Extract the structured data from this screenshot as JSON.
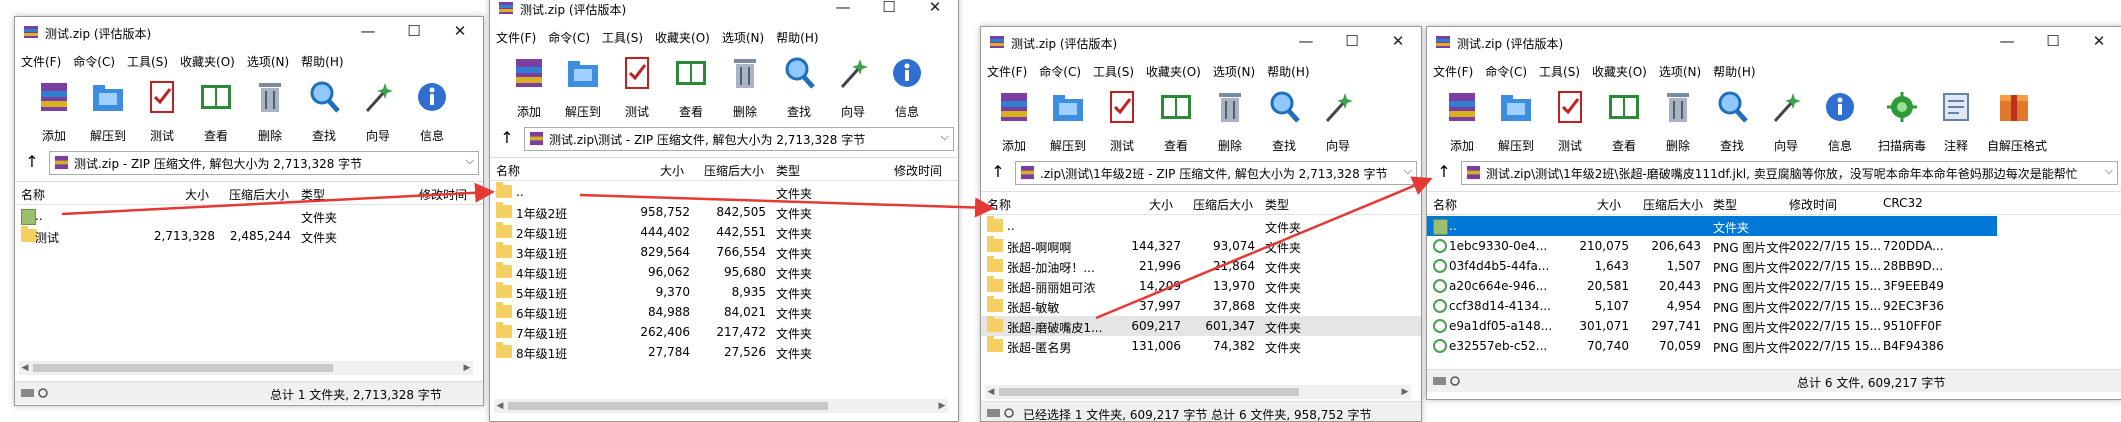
{
  "common": {
    "menu": [
      "文件(F)",
      "命令(C)",
      "工具(S)",
      "收藏夹(O)",
      "选项(N)",
      "帮助(H)"
    ],
    "toolbar": [
      "添加",
      "解压到",
      "测试",
      "查看",
      "删除",
      "查找",
      "向导",
      "信息"
    ],
    "cols": {
      "name": "名称",
      "size": "大小",
      "packed": "压缩后大小",
      "type": "类型",
      "modified": "修改时间",
      "crc": "CRC32"
    },
    "folder_type": "文件夹",
    "png_type": "PNG 图片文件",
    "parent": ".."
  },
  "accent_color": "#0078d7",
  "arrow_color": "#e53935",
  "win1": {
    "title": "测试.zip (评估版本)",
    "address": "测试.zip - ZIP 压缩文件, 解包大小为 2,713,328 字节",
    "rows": [
      {
        "name": "..",
        "size": "",
        "packed": "",
        "type": "文件夹"
      },
      {
        "name": "测试",
        "size": "2,713,328",
        "packed": "2,485,244",
        "type": "文件夹"
      }
    ],
    "status": "总计 1 文件夹, 2,713,328 字节"
  },
  "win2": {
    "title": "测试.zip (评估版本)",
    "address": "测试.zip\\测试 - ZIP 压缩文件, 解包大小为 2,713,328 字节",
    "rows": [
      {
        "name": "..",
        "size": "",
        "packed": "",
        "type": "文件夹"
      },
      {
        "name": "1年级2班",
        "size": "958,752",
        "packed": "842,505",
        "type": "文件夹"
      },
      {
        "name": "2年级1班",
        "size": "444,402",
        "packed": "442,551",
        "type": "文件夹"
      },
      {
        "name": "3年级1班",
        "size": "829,564",
        "packed": "766,554",
        "type": "文件夹"
      },
      {
        "name": "4年级1班",
        "size": "96,062",
        "packed": "95,680",
        "type": "文件夹"
      },
      {
        "name": "5年级1班",
        "size": "9,370",
        "packed": "8,935",
        "type": "文件夹"
      },
      {
        "name": "6年级1班",
        "size": "84,988",
        "packed": "84,021",
        "type": "文件夹"
      },
      {
        "name": "7年级1班",
        "size": "262,406",
        "packed": "217,472",
        "type": "文件夹"
      },
      {
        "name": "8年级1班",
        "size": "27,784",
        "packed": "27,526",
        "type": "文件夹"
      }
    ]
  },
  "win3": {
    "title": "测试.zip (评估版本)",
    "address": ".zip\\测试\\1年级2班 - ZIP 压缩文件, 解包大小为 2,713,328 字节",
    "rows": [
      {
        "name": "..",
        "size": "",
        "packed": "",
        "type": "文件夹"
      },
      {
        "name": "张超-啊啊啊",
        "size": "144,327",
        "packed": "93,074",
        "type": "文件夹"
      },
      {
        "name": "张超-加油呀！...",
        "size": "21,996",
        "packed": "21,864",
        "type": "文件夹"
      },
      {
        "name": "张超-丽丽姐可浓",
        "size": "14,209",
        "packed": "13,970",
        "type": "文件夹"
      },
      {
        "name": "张超-敏敏",
        "size": "37,997",
        "packed": "37,868",
        "type": "文件夹"
      },
      {
        "name": "张超-磨破嘴皮1...",
        "size": "609,217",
        "packed": "601,347",
        "type": "文件夹"
      },
      {
        "name": "张超-匿名男",
        "size": "131,006",
        "packed": "74,382",
        "type": "文件夹"
      }
    ],
    "status": "已经选择 1 文件夹, 609,217 字节     总计 6 文件夹, 958,752 字节"
  },
  "win4": {
    "title": "测试.zip (评估版本)",
    "toolbar_extra": [
      "扫描病毒",
      "注释",
      "自解压格式"
    ],
    "address": "测试.zip\\测试\\1年级2班\\张超-磨破嘴皮111df.jkl, 卖豆腐脑等你放，没写呢本命年本命年爸妈那边每次是能帮忙",
    "rows": [
      {
        "name": "..",
        "size": "",
        "packed": "",
        "type": "文件夹",
        "modified": "",
        "crc": ""
      },
      {
        "name": "1ebc9330-0e4...",
        "size": "210,075",
        "packed": "206,643",
        "type": "PNG 图片文件",
        "modified": "2022/7/15 15...",
        "crc": "720DDA..."
      },
      {
        "name": "03f4d4b5-44fa...",
        "size": "1,643",
        "packed": "1,507",
        "type": "PNG 图片文件",
        "modified": "2022/7/15 15...",
        "crc": "28BB9D..."
      },
      {
        "name": "a20c664e-946...",
        "size": "20,581",
        "packed": "20,443",
        "type": "PNG 图片文件",
        "modified": "2022/7/15 15...",
        "crc": "3F9EEB49"
      },
      {
        "name": "ccf38d14-4134...",
        "size": "5,107",
        "packed": "4,954",
        "type": "PNG 图片文件",
        "modified": "2022/7/15 15...",
        "crc": "92EC3F36"
      },
      {
        "name": "e9a1df05-a148...",
        "size": "301,071",
        "packed": "297,741",
        "type": "PNG 图片文件",
        "modified": "2022/7/15 15...",
        "crc": "9510FF0F"
      },
      {
        "name": "e32557eb-c52...",
        "size": "70,740",
        "packed": "70,059",
        "type": "PNG 图片文件",
        "modified": "2022/7/15 15...",
        "crc": "B4F94386"
      }
    ],
    "status": "总计 6 文件, 609,217 字节"
  }
}
